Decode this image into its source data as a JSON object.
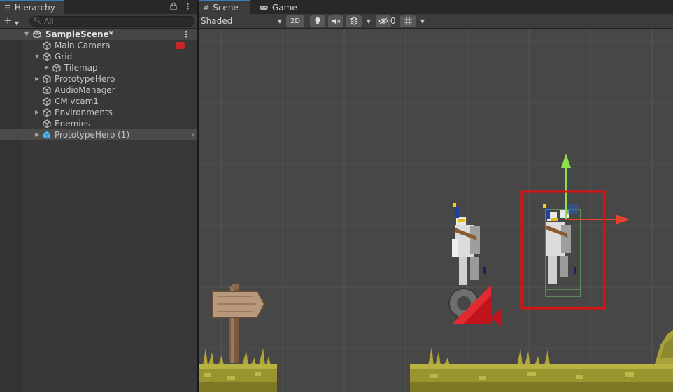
{
  "hierarchy": {
    "tab_label": "Hierarchy",
    "tab_icon": "list-icon",
    "lock_icon": "lock-icon",
    "menu_icon": "kebab-menu-icon",
    "add_button": "+",
    "search_placeholder": "All",
    "scene": {
      "name": "SampleScene*"
    },
    "items": [
      {
        "label": "Main Camera",
        "indent": 1,
        "foldable": false,
        "prefab": false
      },
      {
        "label": "Grid",
        "indent": 1,
        "foldable": true,
        "expanded": true,
        "prefab": false
      },
      {
        "label": "Tilemap",
        "indent": 2,
        "foldable": true,
        "expanded": false,
        "prefab": false
      },
      {
        "label": "PrototypeHero",
        "indent": 1,
        "foldable": true,
        "expanded": false,
        "prefab": false
      },
      {
        "label": "AudioManager",
        "indent": 1,
        "foldable": false,
        "prefab": false
      },
      {
        "label": "CM vcam1",
        "indent": 1,
        "foldable": false,
        "prefab": false
      },
      {
        "label": "Environments",
        "indent": 1,
        "foldable": true,
        "expanded": false,
        "prefab": false
      },
      {
        "label": "Enemies",
        "indent": 1,
        "foldable": false,
        "prefab": false
      },
      {
        "label": "PrototypeHero (1)",
        "indent": 1,
        "foldable": true,
        "expanded": false,
        "prefab": true,
        "selected": true
      }
    ]
  },
  "scene_view": {
    "tabs": [
      {
        "label": "Scene",
        "icon": "grid-icon",
        "active": true
      },
      {
        "label": "Game",
        "icon": "gamepad-icon",
        "active": false
      }
    ],
    "shading_mode": "Shaded",
    "mode_2d": "2D",
    "hidden_count": "0",
    "toolbar_icons": [
      "lighting-bulb-icon",
      "audio-speaker-icon",
      "effects-icon",
      "visibility-icon",
      "grid-snap-icon"
    ]
  },
  "colors": {
    "selection_outline": "#e01010",
    "gizmo_y": "#8ee04a",
    "gizmo_x": "#e8442a",
    "camera_gizmo": "#c0141c",
    "grass": "#98942e"
  }
}
